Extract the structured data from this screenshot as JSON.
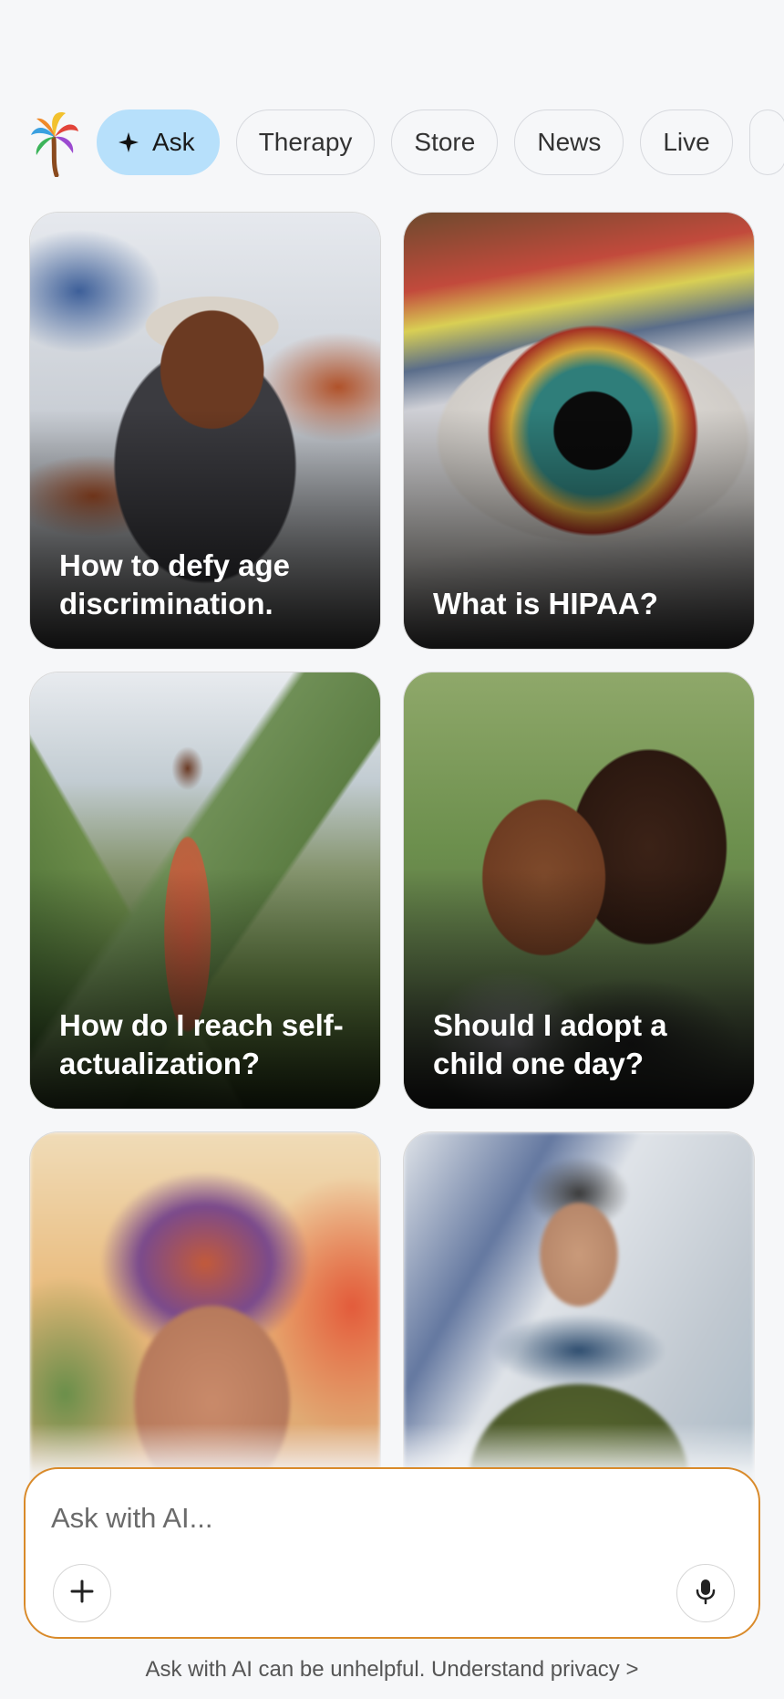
{
  "nav": {
    "logo_icon": "palm-tree-logo",
    "tabs": [
      {
        "label": "Ask",
        "icon": "sparkle-icon",
        "active": true
      },
      {
        "label": "Therapy"
      },
      {
        "label": "Store"
      },
      {
        "label": "News"
      },
      {
        "label": "Live"
      }
    ]
  },
  "cards": [
    {
      "caption": "How to defy age discrimination."
    },
    {
      "caption": "What is HIPAA?"
    },
    {
      "caption": "How do I reach self-actualization?"
    },
    {
      "caption": "Should I adopt a child one day?"
    },
    {
      "caption": ""
    },
    {
      "caption": ""
    }
  ],
  "ask": {
    "placeholder": "Ask with AI...",
    "add_icon": "plus-icon",
    "mic_icon": "microphone-icon",
    "disclaimer": "Ask with AI can be unhelpful. Understand privacy >"
  },
  "colors": {
    "active_tab": "#b7e0fb",
    "input_border": "#d98a2a",
    "background": "#f6f7f9"
  }
}
